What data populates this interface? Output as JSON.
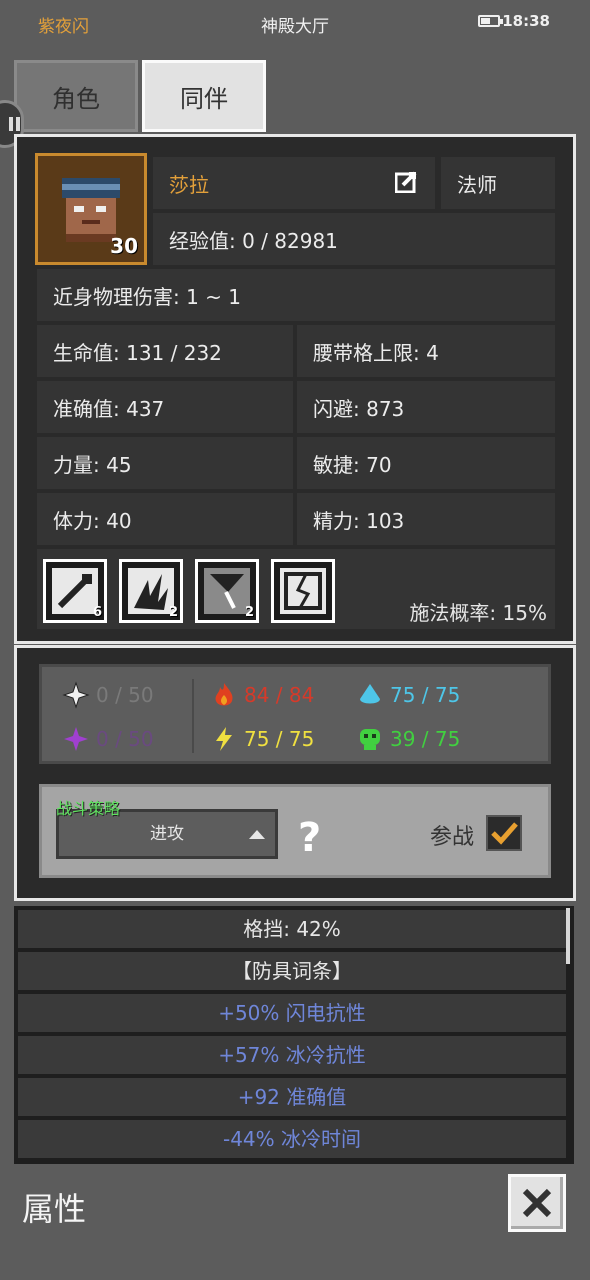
{
  "status_bar": {
    "app_name": "紫夜闪",
    "location": "神殿大厅",
    "time": "18:38"
  },
  "tabs": [
    {
      "label": "角色",
      "active": false
    },
    {
      "label": "同伴",
      "active": true
    }
  ],
  "character": {
    "name": "莎拉",
    "class": "法师",
    "level": "30",
    "experience": "经验值: 0 / 82981",
    "melee_damage": "近身物理伤害: 1 ~ 1",
    "stats": {
      "hp": "生命值: 131 / 232",
      "belt_limit": "腰带格上限: 4",
      "accuracy": "准确值: 437",
      "dodge": "闪避: 873",
      "strength": "力量: 45",
      "agility": "敏捷: 70",
      "stamina": "体力: 40",
      "energy": "精力: 103"
    },
    "skills": [
      {
        "icon": "wand-icon",
        "count": "6"
      },
      {
        "icon": "flame-burst-icon",
        "count": "2"
      },
      {
        "icon": "broken-sword-icon",
        "count": "2"
      },
      {
        "icon": "cracked-shield-icon",
        "count": ""
      }
    ],
    "cast_rate": "施法概率: 15%"
  },
  "resistances": {
    "physical": "0 / 50",
    "poison_purple": "0 / 50",
    "fire": "84 / 84",
    "lightning": "75 / 75",
    "cold": "75 / 75",
    "poison": "39 / 75"
  },
  "strategy": {
    "label": "战斗策略",
    "selected": "进攻",
    "help": "?",
    "join_label": "参战",
    "join_checked": true
  },
  "property_list": [
    {
      "text": "格挡: 42%",
      "color": "#e6e6e6"
    },
    {
      "text": "【防具词条】",
      "color": "#e6e6e6"
    },
    {
      "text": "+50% 闪电抗性",
      "color": "#6f86d9"
    },
    {
      "text": "+57% 冰冷抗性",
      "color": "#6f86d9"
    },
    {
      "text": "+92 准确值",
      "color": "#6f86d9"
    },
    {
      "text": "-44% 冰冷时间",
      "color": "#6f86d9"
    }
  ],
  "bottom": {
    "title": "属性",
    "close": "×"
  },
  "colors": {
    "fire": "#d63a2a",
    "lightning": "#f0e040",
    "cold": "#4ec6e8",
    "poison": "#41d040",
    "purple": "#a040d0",
    "gray_text": "#7a7a7a",
    "name_orange": "#e3a03a"
  }
}
